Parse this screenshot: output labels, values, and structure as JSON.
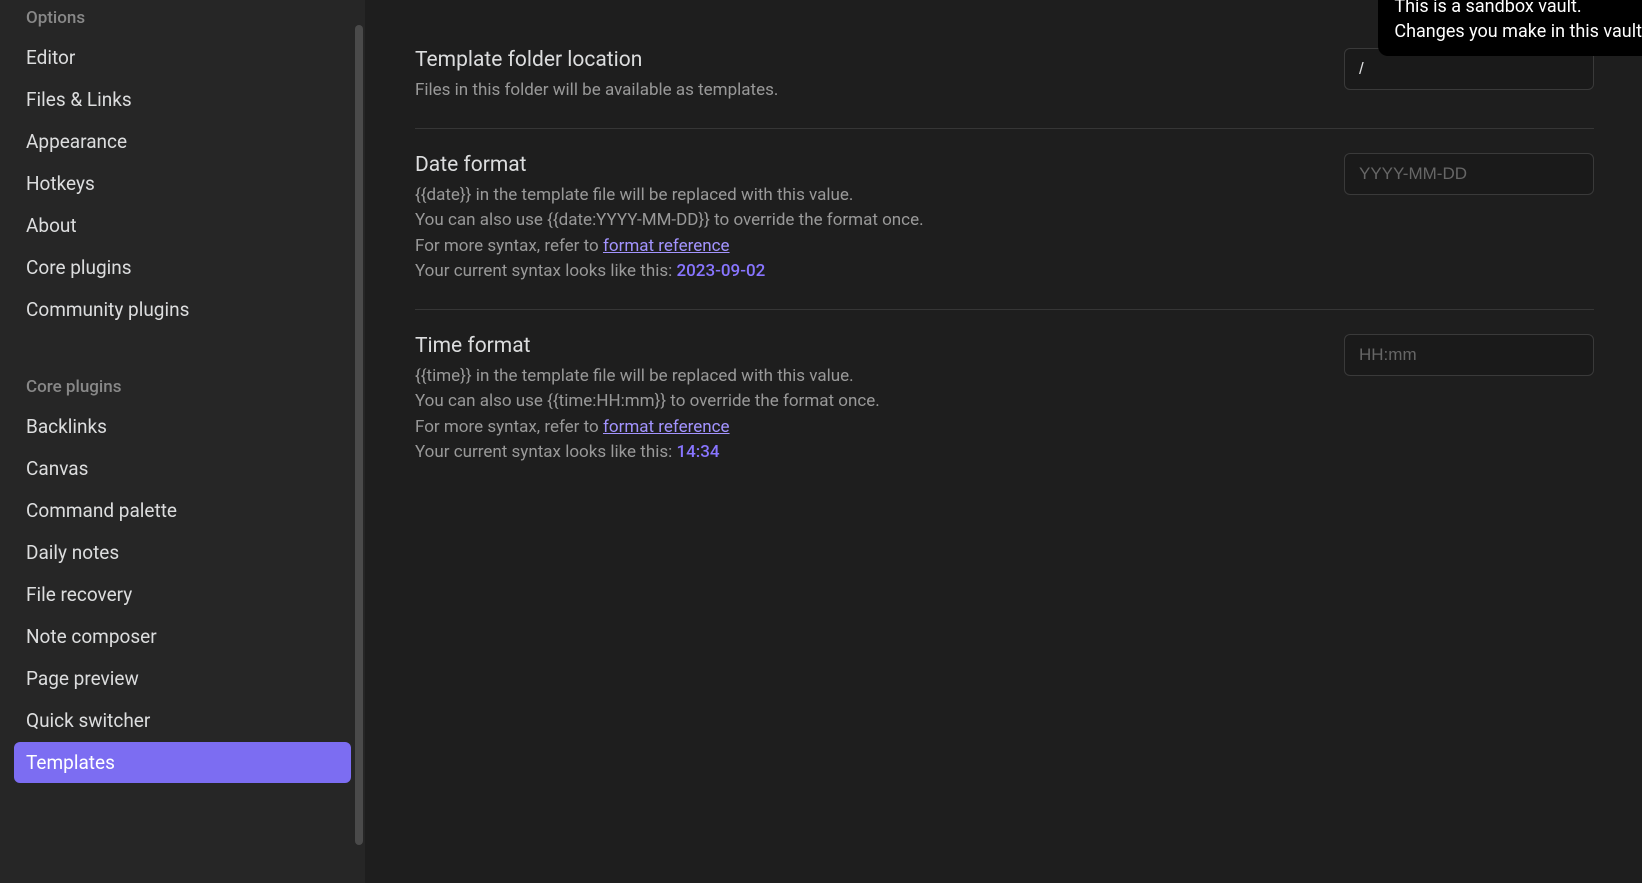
{
  "sidebar": {
    "section1_header": "Options",
    "section1_items": [
      {
        "label": "Editor"
      },
      {
        "label": "Files & Links"
      },
      {
        "label": "Appearance"
      },
      {
        "label": "Hotkeys"
      },
      {
        "label": "About"
      },
      {
        "label": "Core plugins"
      },
      {
        "label": "Community plugins"
      }
    ],
    "section2_header": "Core plugins",
    "section2_items": [
      {
        "label": "Backlinks"
      },
      {
        "label": "Canvas"
      },
      {
        "label": "Command palette"
      },
      {
        "label": "Daily notes"
      },
      {
        "label": "File recovery"
      },
      {
        "label": "Note composer"
      },
      {
        "label": "Page preview"
      },
      {
        "label": "Quick switcher"
      },
      {
        "label": "Templates"
      }
    ]
  },
  "settings": {
    "template_folder": {
      "name": "Template folder location",
      "description": "Files in this folder will be available as templates.",
      "value": "/"
    },
    "date_format": {
      "name": "Date format",
      "desc_line1": "{{date}} in the template file will be replaced with this value.",
      "desc_line2": "You can also use {{date:YYYY-MM-DD}} to override the format once.",
      "desc_line3_prefix": "For more syntax, refer to ",
      "desc_line3_link": "format reference",
      "desc_line4_prefix": "Your current syntax looks like this: ",
      "desc_line4_value": "2023-09-02",
      "placeholder": "YYYY-MM-DD"
    },
    "time_format": {
      "name": "Time format",
      "desc_line1": "{{time}} in the template file will be replaced with this value.",
      "desc_line2": "You can also use {{time:HH:mm}} to override the format once.",
      "desc_line3_prefix": "For more syntax, refer to ",
      "desc_line3_link": "format reference",
      "desc_line4_prefix": "Your current syntax looks like this: ",
      "desc_line4_value": "14:34",
      "placeholder": "HH:mm"
    }
  },
  "notice": {
    "line1": "This is a sandbox vault.",
    "line2": "Changes you make in this vault"
  }
}
